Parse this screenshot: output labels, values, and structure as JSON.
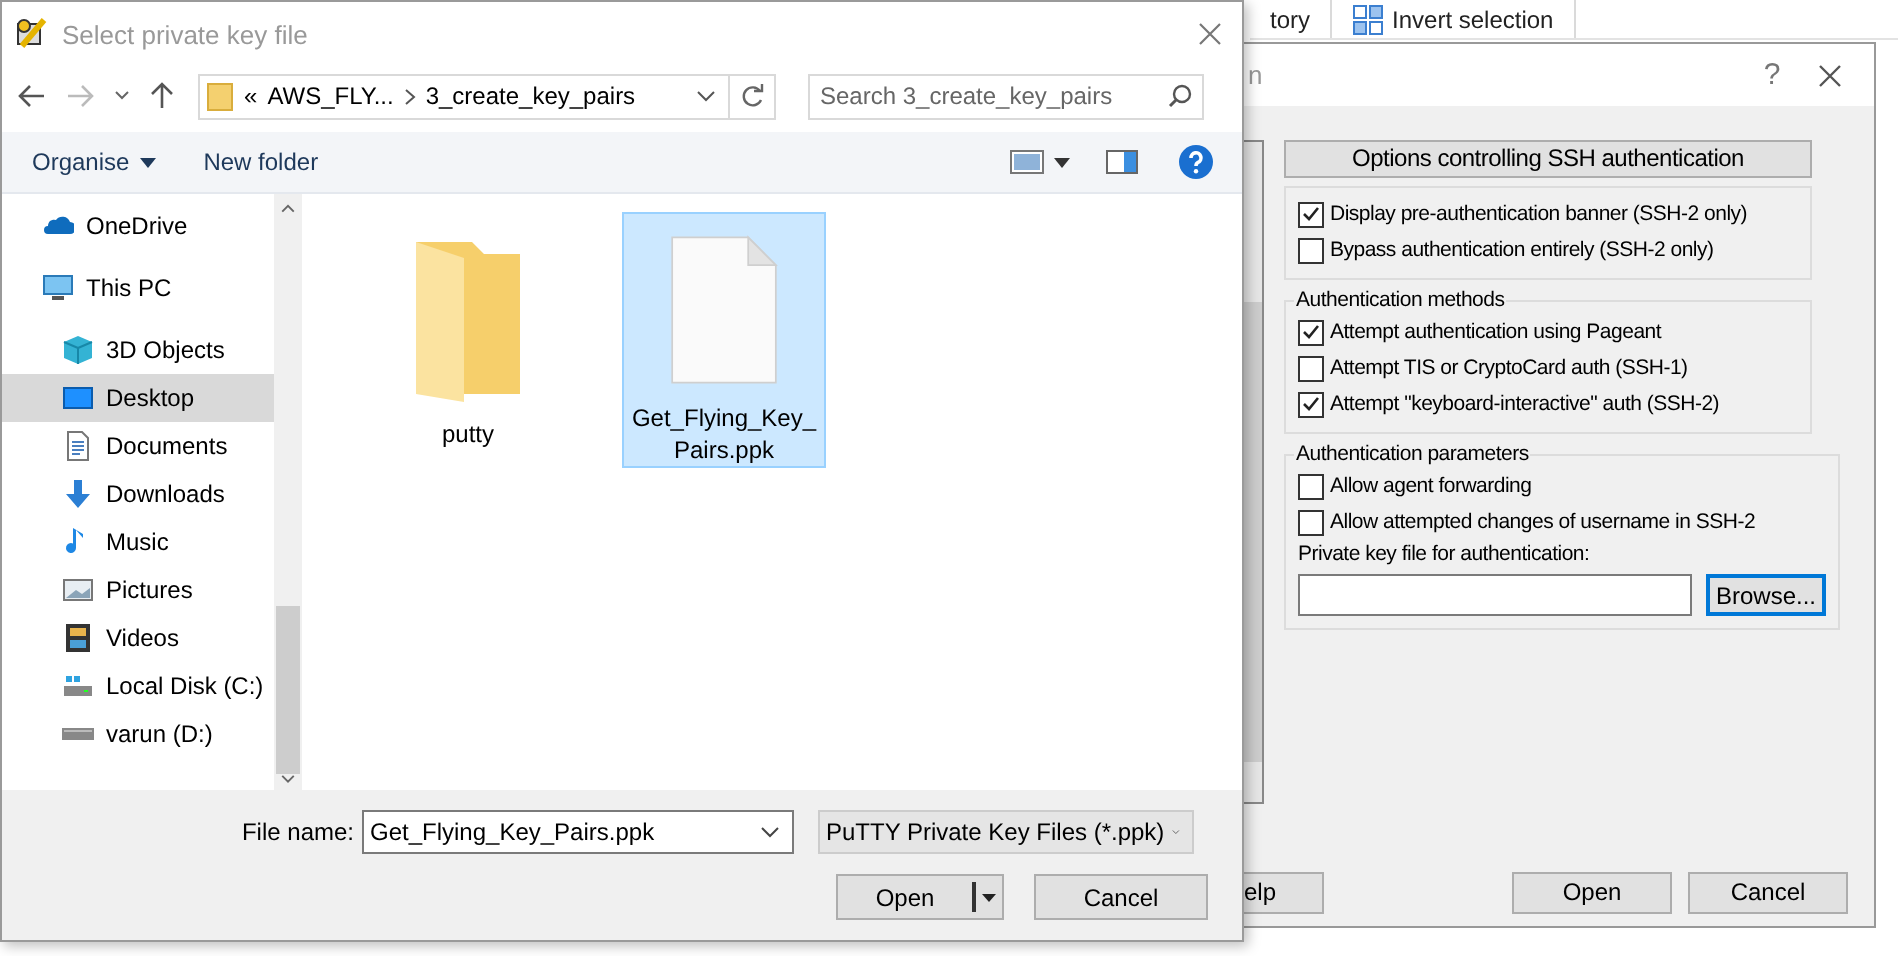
{
  "background_window": {
    "ribbon_items": [
      {
        "label": "tory"
      },
      {
        "label": "Invert selection"
      }
    ]
  },
  "putty_dialog": {
    "title": "n",
    "help_button": "?",
    "section_header": "Options controlling SSH authentication",
    "groups": [
      {
        "items": [
          {
            "label": "Display pre-authentication banner (SSH-2 only)",
            "checked": true
          },
          {
            "label": "Bypass authentication entirely (SSH-2 only)",
            "checked": false
          }
        ]
      },
      {
        "title": "Authentication methods",
        "items": [
          {
            "label": "Attempt authentication using Pageant",
            "checked": true
          },
          {
            "label": "Attempt TIS or CryptoCard auth (SSH-1)",
            "checked": false
          },
          {
            "label": "Attempt \"keyboard-interactive\" auth (SSH-2)",
            "checked": true
          }
        ]
      },
      {
        "title": "Authentication parameters",
        "items": [
          {
            "label": "Allow agent forwarding",
            "checked": false
          },
          {
            "label": "Allow attempted changes of username in SSH-2",
            "checked": false
          }
        ],
        "key_file": {
          "label": "Private key file for authentication:"
        },
        "browse": {
          "label": "Browse...",
          "focused": true
        }
      }
    ],
    "buttons": [
      {
        "label": "elp"
      },
      {
        "label": "Open"
      },
      {
        "label": "Cancel"
      }
    ]
  },
  "file_dialog": {
    "title": "Select private key file",
    "address": {
      "prefix": "«",
      "crumbs": [
        "AWS_FLY...",
        "3_create_key_pairs"
      ]
    },
    "search": {
      "placeholder": "Search 3_create_key_pairs"
    },
    "toolbar": [
      "Organise",
      "New folder"
    ],
    "nav": [
      {
        "label": "OneDrive",
        "selected": false
      },
      {
        "label": "This PC",
        "selected": false,
        "children": [
          {
            "label": "3D Objects",
            "selected": false
          },
          {
            "label": "Desktop",
            "selected": true
          },
          {
            "label": "Documents",
            "selected": false
          },
          {
            "label": "Downloads",
            "selected": false
          },
          {
            "label": "Music",
            "selected": false
          },
          {
            "label": "Pictures",
            "selected": false
          },
          {
            "label": "Videos",
            "selected": false
          },
          {
            "label": "Local Disk (C:)",
            "selected": false
          },
          {
            "label": "varun (D:)",
            "selected": false
          }
        ]
      }
    ],
    "files": [
      {
        "name": "putty",
        "kind": "folder",
        "selected": false
      },
      {
        "name": "Get_Flying_Key_Pairs.ppk",
        "kind": "file",
        "selected": true
      }
    ],
    "file_name": {
      "label": "File name:",
      "value": "Get_Flying_Key_Pairs.ppk"
    },
    "filter": {
      "value": "PuTTY Private Key Files (*.ppk)"
    },
    "buttons": [
      {
        "label": "Open",
        "kind": "split"
      },
      {
        "label": "Cancel",
        "kind": "plain"
      }
    ]
  }
}
